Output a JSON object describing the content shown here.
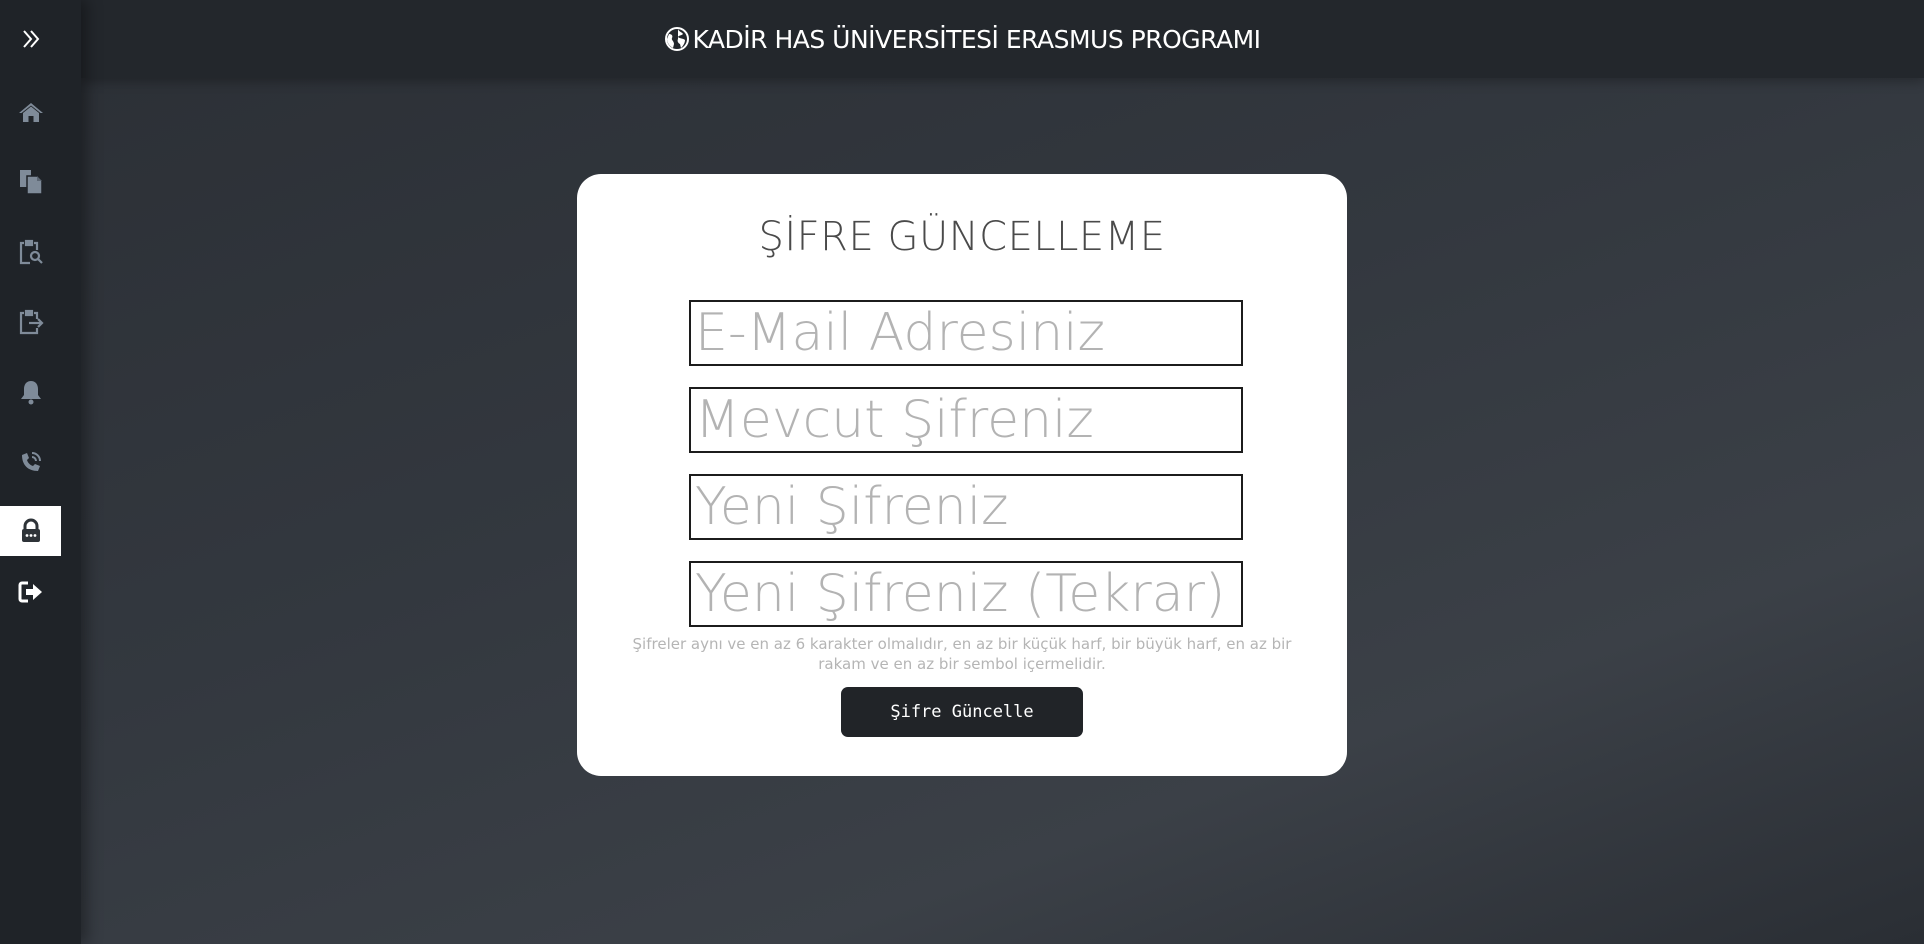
{
  "header": {
    "title": "KADİR HAS ÜNİVERSİTESİ ERASMUS PROGRAMI",
    "icon": "globe-icon"
  },
  "sidebar": {
    "toggle_icon": "double-chevron-right-icon",
    "items": [
      {
        "name": "home",
        "icon": "home-icon"
      },
      {
        "name": "documents",
        "icon": "copy-files-icon"
      },
      {
        "name": "search-applications",
        "icon": "clipboard-search-icon"
      },
      {
        "name": "transfer-applications",
        "icon": "clipboard-arrow-icon"
      },
      {
        "name": "notifications",
        "icon": "bell-icon"
      },
      {
        "name": "contact",
        "icon": "phone-icon"
      },
      {
        "name": "change-password",
        "icon": "lock-icon",
        "active": true
      },
      {
        "name": "logout",
        "icon": "sign-out-icon"
      }
    ]
  },
  "form": {
    "title": "ŞİFRE GÜNCELLEME",
    "email_placeholder": "E-Mail Adresiniz",
    "current_password_placeholder": "Mevcut Şifreniz",
    "new_password_placeholder": "Yeni Şifreniz",
    "new_password_repeat_placeholder": "Yeni Şifreniz (Tekrar)",
    "hint": "Şifreler aynı ve en az 6 karakter olmalıdır, en az bir küçük harf, bir büyük harf, en az bir rakam ve en az bir sembol içermelidir.",
    "submit_label": "Şifre Güncelle"
  },
  "colors": {
    "sidebar_bg": "#1f2328",
    "topbar_bg": "#23272c",
    "icon_color": "#7f8b99",
    "button_bg": "#212428"
  }
}
